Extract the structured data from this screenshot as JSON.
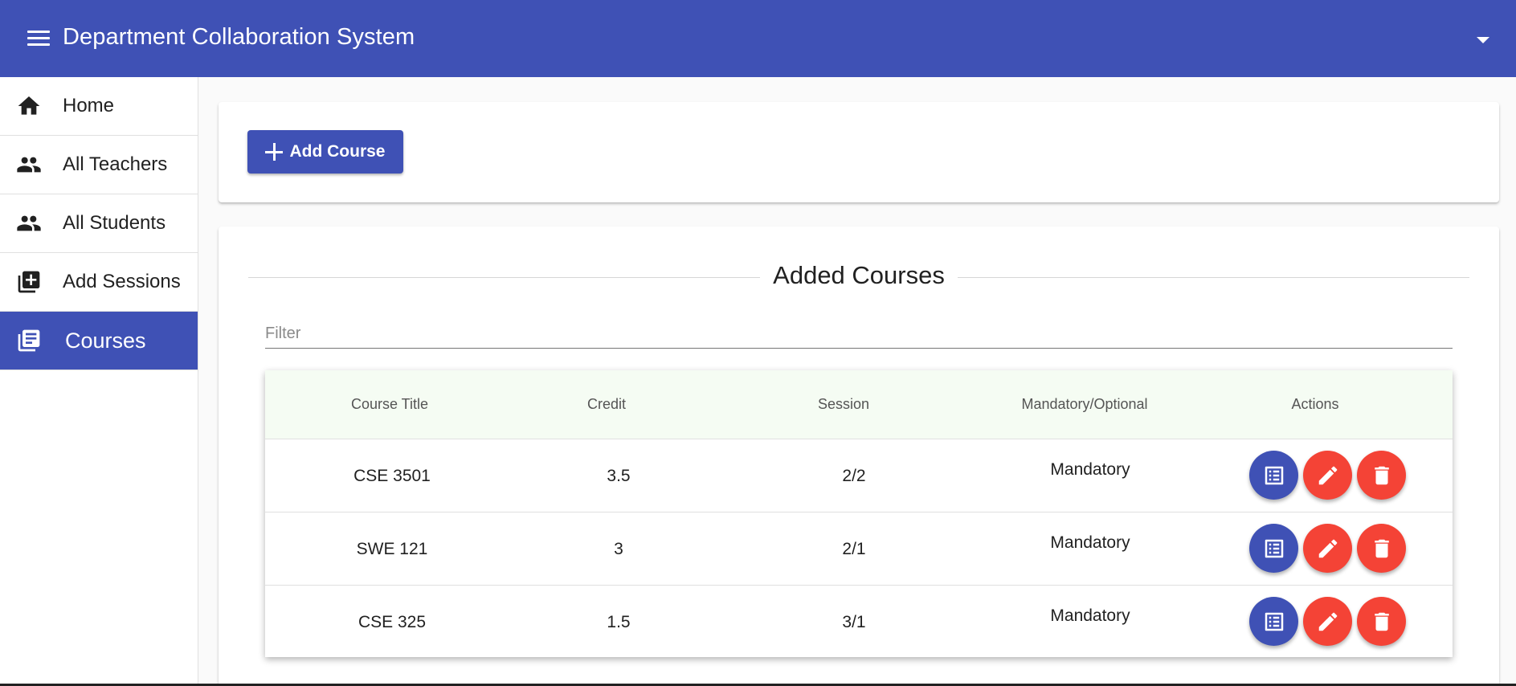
{
  "app": {
    "title": "Department Collaboration System"
  },
  "sidebar": {
    "items": [
      {
        "label": "Home",
        "icon": "home-icon"
      },
      {
        "label": "All Teachers",
        "icon": "people-icon"
      },
      {
        "label": "All Students",
        "icon": "people-icon"
      },
      {
        "label": "Add Sessions",
        "icon": "library-add-icon"
      },
      {
        "label": "Courses",
        "icon": "library-books-icon",
        "active": true
      }
    ]
  },
  "toolbar": {
    "add_course_label": "Add Course"
  },
  "courses": {
    "section_title": "Added Courses",
    "filter_placeholder": "Filter",
    "columns": [
      "Course Title",
      "Credit",
      "Session",
      "Mandatory/Optional",
      "Actions"
    ],
    "rows": [
      {
        "title": "CSE 3501",
        "credit": "3.5",
        "session": "2/2",
        "type": "Mandatory"
      },
      {
        "title": "SWE 121",
        "credit": "3",
        "session": "2/1",
        "type": "Mandatory"
      },
      {
        "title": "CSE 325",
        "credit": "1.5",
        "session": "3/1",
        "type": "Mandatory"
      }
    ],
    "action_icons": [
      "view-list-icon",
      "edit-icon",
      "delete-icon"
    ]
  },
  "colors": {
    "primary": "#3f51b5",
    "danger": "#f44336",
    "table_header_bg": "#f5fcf3"
  }
}
